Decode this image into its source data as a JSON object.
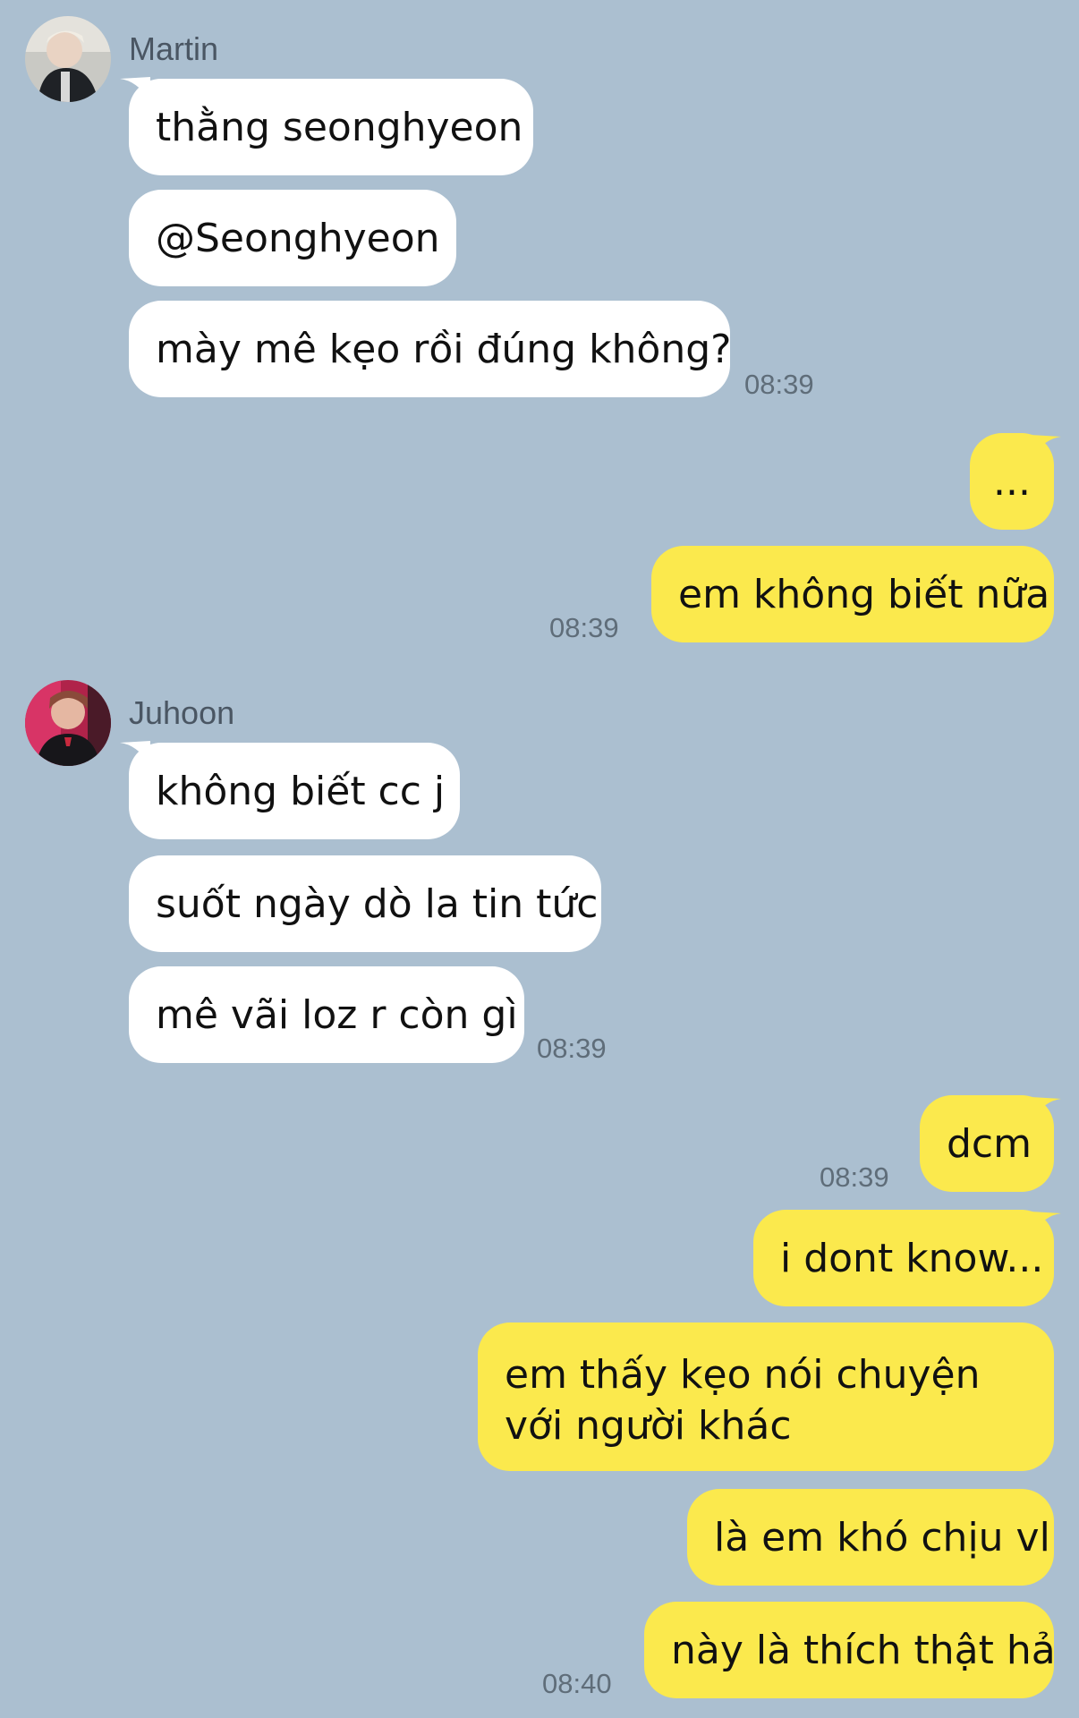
{
  "colors": {
    "background": "#abbfd0",
    "incoming": "#ffffff",
    "outgoing": "#fbe94d",
    "time": "#5f6d79"
  },
  "groups": [
    {
      "sender": "Martin",
      "messages": [
        "thằng seonghyeon",
        "@Seonghyeon",
        "mày mê kẹo rồi đúng không?"
      ],
      "time": "08:39"
    },
    {
      "direction": "outgoing",
      "messages": [
        "...",
        "em không biết nữa"
      ],
      "time": "08:39"
    },
    {
      "sender": "Juhoon",
      "messages": [
        "không biết cc j",
        "suốt ngày dò la tin tức",
        "mê vãi loz r còn gì"
      ],
      "time": "08:39"
    },
    {
      "direction": "outgoing",
      "messages": [
        "dcm"
      ],
      "time": "08:39"
    },
    {
      "direction": "outgoing",
      "messages": [
        "i dont know...",
        "em thấy kẹo nói chuyện với người khác",
        "là em khó chịu vl",
        "này là thích thật hả"
      ],
      "time": "08:40"
    }
  ]
}
